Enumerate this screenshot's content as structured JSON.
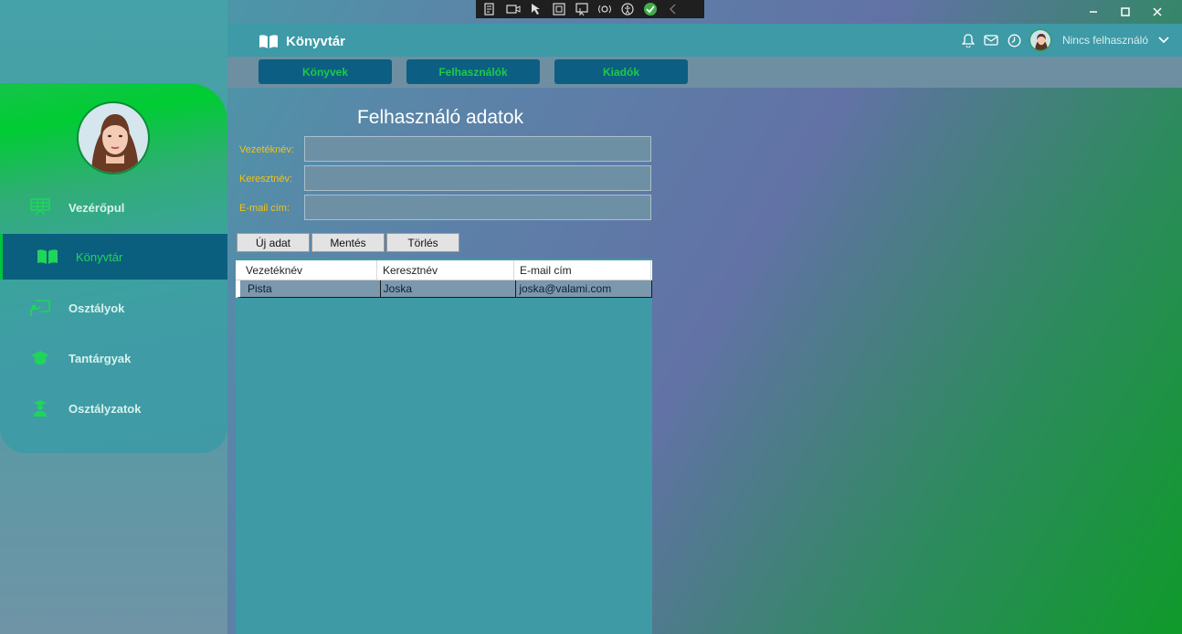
{
  "window": {
    "minimize_icon": "minimize-icon",
    "maximize_icon": "maximize-icon",
    "close_icon": "close-icon"
  },
  "header": {
    "title": "Könyvtár",
    "title_icon": "book-open-icon",
    "user_name": "Nincs felhasználó"
  },
  "tabs": [
    {
      "label": "Könyvek"
    },
    {
      "label": "Felhasználók"
    },
    {
      "label": "Kiadók"
    }
  ],
  "sidebar": {
    "items": [
      {
        "label": "Vezérőpul",
        "icon": "dashboard-icon"
      },
      {
        "label": "Könyvtár",
        "icon": "book-icon",
        "active": true
      },
      {
        "label": "Osztályok",
        "icon": "classroom-icon"
      },
      {
        "label": "Tantárgyak",
        "icon": "subject-icon"
      },
      {
        "label": "Osztályzatok",
        "icon": "grades-icon"
      }
    ]
  },
  "form": {
    "title": "Felhasználó adatok",
    "fields": [
      {
        "label": "Vezetéknév:",
        "value": ""
      },
      {
        "label": "Keresztnév:",
        "value": ""
      },
      {
        "label": "E-mail cím:",
        "value": ""
      }
    ],
    "buttons": {
      "new": "Új adat",
      "save": "Mentés",
      "delete": "Törlés"
    }
  },
  "table": {
    "columns": [
      "Vezetéknév",
      "Keresztnév",
      "E-mail cím"
    ],
    "rows": [
      [
        "Pista",
        "Joska",
        "joska@valami.com"
      ]
    ]
  },
  "colors": {
    "accent_green": "#1ec94b",
    "label_yellow": "#f2c218",
    "tab_blue": "#0c5f82"
  }
}
